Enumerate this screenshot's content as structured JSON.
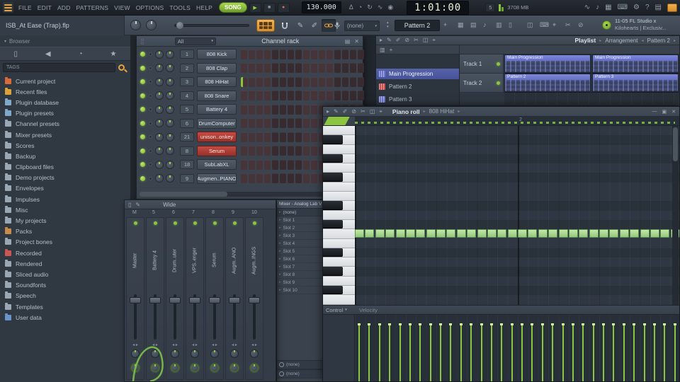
{
  "app": {
    "menu": [
      "FILE",
      "EDIT",
      "ADD",
      "PATTERNS",
      "VIEW",
      "OPTIONS",
      "TOOLS",
      "HELP"
    ],
    "transport": {
      "mode": "SONG",
      "tempo": "130.000",
      "time": "1:01:00"
    },
    "status": {
      "polyphony": "5",
      "memory": "3708 MB"
    },
    "hint": {
      "line1": "11-05  FL Studio x",
      "line2": "Kilohearts | Exclusiv..."
    }
  },
  "toolbar": {
    "project_title": "ISB_At Ease (Trap).flp",
    "none_selector": "(none)",
    "pattern_selector": "Pattern 2",
    "add_label": "+"
  },
  "browser": {
    "header": "Browser",
    "tags_label": "TAGS",
    "items": [
      {
        "label": "Current project",
        "color": "#d96a3a",
        "icon": "folder"
      },
      {
        "label": "Recent files",
        "color": "#d9a23a",
        "icon": "folder"
      },
      {
        "label": "Plugin database",
        "color": "#7fa8c9",
        "icon": "plug"
      },
      {
        "label": "Plugin presets",
        "color": "#7fa8c9",
        "icon": "plug"
      },
      {
        "label": "Channel presets",
        "color": "#9aa8b5",
        "icon": "folder"
      },
      {
        "label": "Mixer presets",
        "color": "#9aa8b5",
        "icon": "sliders"
      },
      {
        "label": "Scores",
        "color": "#9aa8b5",
        "icon": "note"
      },
      {
        "label": "Backup",
        "color": "#9aa8b5",
        "icon": "folder"
      },
      {
        "label": "Clipboard files",
        "color": "#9aa8b5",
        "icon": "clipboard"
      },
      {
        "label": "Demo projects",
        "color": "#9aa8b5",
        "icon": "folder"
      },
      {
        "label": "Envelopes",
        "color": "#9aa8b5",
        "icon": "folder"
      },
      {
        "label": "Impulses",
        "color": "#9aa8b5",
        "icon": "folder"
      },
      {
        "label": "Misc",
        "color": "#9aa8b5",
        "icon": "folder"
      },
      {
        "label": "My projects",
        "color": "#9aa8b5",
        "icon": "folder"
      },
      {
        "label": "Packs",
        "color": "#c98b4a",
        "icon": "box"
      },
      {
        "label": "Project bones",
        "color": "#9aa8b5",
        "icon": "folder"
      },
      {
        "label": "Recorded",
        "color": "#cc5555",
        "icon": "record"
      },
      {
        "label": "Rendered",
        "color": "#9aa8b5",
        "icon": "folder"
      },
      {
        "label": "Sliced audio",
        "color": "#9aa8b5",
        "icon": "wave"
      },
      {
        "label": "Soundfonts",
        "color": "#9aa8b5",
        "icon": "folder"
      },
      {
        "label": "Speech",
        "color": "#9aa8b5",
        "icon": "speech"
      },
      {
        "label": "Templates",
        "color": "#9aa8b5",
        "icon": "folder"
      },
      {
        "label": "User data",
        "color": "#6a93c9",
        "icon": "user"
      }
    ]
  },
  "channel_rack": {
    "filter_label": "All",
    "title": "Channel rack",
    "channels": [
      {
        "num": "1",
        "name": "808 Kick",
        "red": false,
        "steps": "0000000000000000"
      },
      {
        "num": "2",
        "name": "808 Clap",
        "red": false,
        "steps": "0000000000000000"
      },
      {
        "num": "3",
        "name": "808 HiHat",
        "red": false,
        "steps": "0000000000000000",
        "preview": true
      },
      {
        "num": "4",
        "name": "808 Snare",
        "red": false,
        "steps": "0000000000000000"
      },
      {
        "num": "5",
        "name": "Battery 4",
        "red": false,
        "steps": "0000000000000000"
      },
      {
        "num": "6",
        "name": "DrumComputer",
        "red": false,
        "steps": "0000000000000000"
      },
      {
        "num": "21",
        "name": "unison..onkey",
        "red": true,
        "steps": "0000000000000000"
      },
      {
        "num": "8",
        "name": "Serum",
        "red": true,
        "steps": "0000000000000000"
      },
      {
        "num": "18",
        "name": "SubLabXL",
        "red": false,
        "steps": "0000000000000000"
      },
      {
        "num": "9",
        "name": "Augmen..PIANO",
        "red": false,
        "steps": "0000000000000000"
      }
    ]
  },
  "mixer": {
    "view_label": "Wide",
    "master_label": "M",
    "track_numbers": [
      "5",
      "6",
      "7",
      "8",
      "9",
      "10"
    ],
    "strips": [
      {
        "name": "Master"
      },
      {
        "name": "Battery 4"
      },
      {
        "name": "Drum..uter"
      },
      {
        "name": "VPS..enger"
      },
      {
        "name": "Serum"
      },
      {
        "name": "Augm..ANO"
      },
      {
        "name": "Augm..INGS"
      }
    ]
  },
  "plugin_rack": {
    "title": "Mixer - Analog Lab V",
    "top_slot": "(none)",
    "slots": [
      "Slot 1",
      "Slot 2",
      "Slot 3",
      "Slot 4",
      "Slot 5",
      "Slot 6",
      "Slot 7",
      "Slot 8",
      "Slot 9",
      "Slot 10"
    ],
    "bottom_slots": [
      "(none)",
      "(none)"
    ]
  },
  "playlist": {
    "title": "Playlist",
    "breadcrumb1": "Arrangement",
    "breadcrumb2": "Pattern 2",
    "patterns": [
      {
        "name": "Main Progression",
        "color": "#6a76cc",
        "selected": true
      },
      {
        "name": "Pattern 2",
        "color": "#cc4f4f",
        "selected": false
      },
      {
        "name": "Pattern 3",
        "color": "#6a76cc",
        "selected": false
      }
    ],
    "tracks": [
      "Track 1",
      "Track 2"
    ],
    "clips": [
      {
        "lane": 0,
        "slot": 0,
        "label": "Main Progression"
      },
      {
        "lane": 0,
        "slot": 1,
        "label": "Main Progression"
      },
      {
        "lane": 1,
        "slot": 0,
        "label": "Pattern 2"
      },
      {
        "lane": 1,
        "slot": 1,
        "label": "Pattern 3"
      }
    ]
  },
  "piano_roll": {
    "title": "Piano roll",
    "channel": "808 HiHat",
    "bar_label": "2",
    "control_label": "Control",
    "lane_label": "Velocity",
    "note_count": 32
  },
  "icons": {
    "play": "▶",
    "stop": "■",
    "record": "●",
    "up": "▴",
    "down": "▾",
    "left": "◂",
    "right": "▸",
    "close": "✕",
    "plus": "+",
    "minus": "—",
    "maximize": "▣",
    "star": "★",
    "gear": "⚙",
    "help": "?",
    "note": "♪",
    "grid": "▦",
    "list": "▤",
    "page": "▯",
    "wave": "∿",
    "clock": "◔",
    "keyboard": "⌨",
    "pencil": "✎",
    "brush": "✐",
    "cut": "✂",
    "target": "⌖",
    "mute": "⊘",
    "drag": "⣿",
    "speaker": "◀",
    "circle": "◉",
    "box": "▭",
    "columns": "▥",
    "squares": "◫",
    "delta": "Δ",
    "loop": "↻"
  }
}
